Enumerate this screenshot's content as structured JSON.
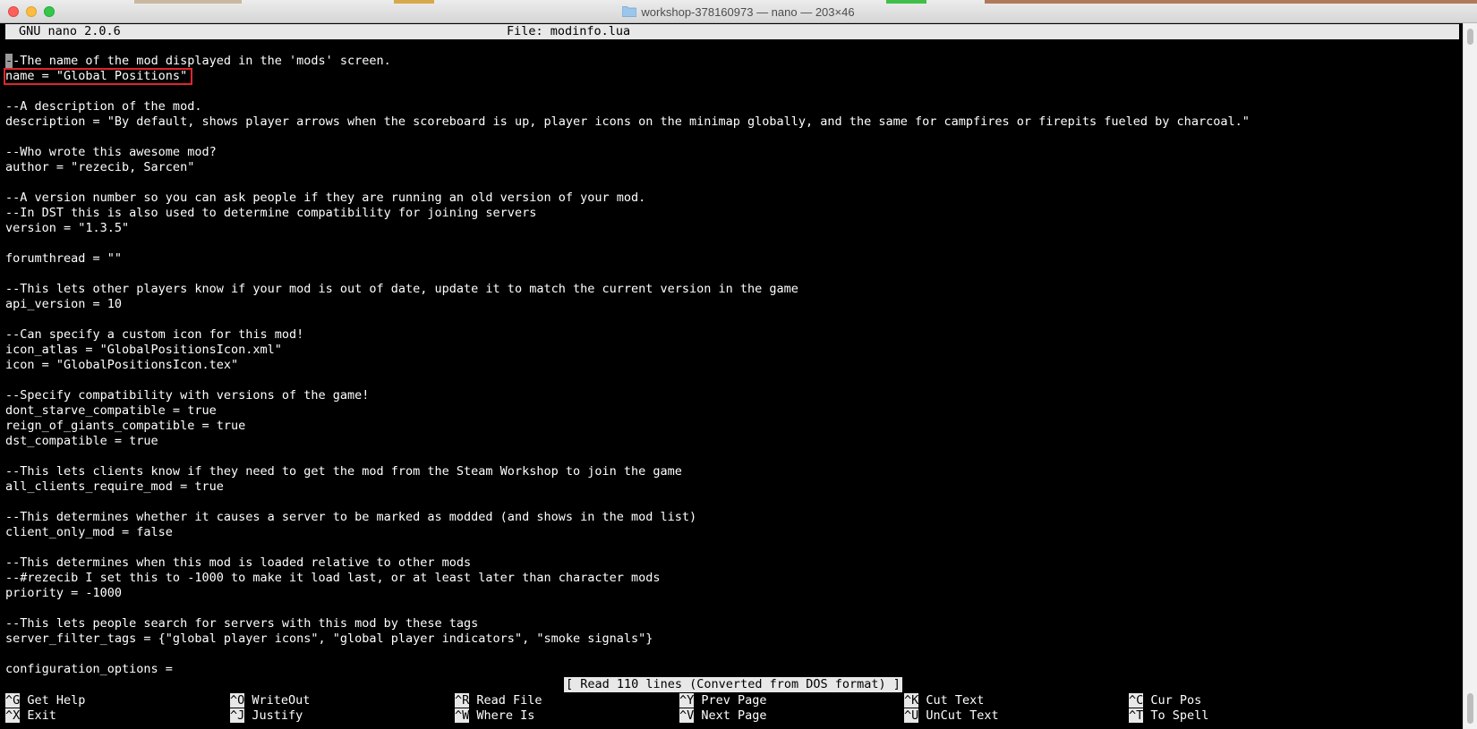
{
  "window": {
    "title": "workshop-378160973 — nano — 203×46"
  },
  "nano": {
    "version_label": "GNU nano 2.0.6",
    "file_label": "File: modinfo.lua",
    "status_message": "[ Read 110 lines (Converted from DOS format) ]"
  },
  "code_lines": [
    "--The name of the mod displayed in the 'mods' screen.",
    "name = \"Global Positions\"",
    "",
    "--A description of the mod.",
    "description = \"By default, shows player arrows when the scoreboard is up, player icons on the minimap globally, and the same for campfires or firepits fueled by charcoal.\"",
    "",
    "--Who wrote this awesome mod?",
    "author = \"rezecib, Sarcen\"",
    "",
    "--A version number so you can ask people if they are running an old version of your mod.",
    "--In DST this is also used to determine compatibility for joining servers",
    "version = \"1.3.5\"",
    "",
    "forumthread = \"\"",
    "",
    "--This lets other players know if your mod is out of date, update it to match the current version in the game",
    "api_version = 10",
    "",
    "--Can specify a custom icon for this mod!",
    "icon_atlas = \"GlobalPositionsIcon.xml\"",
    "icon = \"GlobalPositionsIcon.tex\"",
    "",
    "--Specify compatibility with versions of the game!",
    "dont_starve_compatible = true",
    "reign_of_giants_compatible = true",
    "dst_compatible = true",
    "",
    "--This lets clients know if they need to get the mod from the Steam Workshop to join the game",
    "all_clients_require_mod = true",
    "",
    "--This determines whether it causes a server to be marked as modded (and shows in the mod list)",
    "client_only_mod = false",
    "",
    "--This determines when this mod is loaded relative to other mods",
    "--#rezecib I set this to -1000 to make it load last, or at least later than character mods",
    "priority = -1000",
    "",
    "--This lets people search for servers with this mod by these tags",
    "server_filter_tags = {\"global player icons\", \"global player indicators\", \"smoke signals\"}",
    "",
    "configuration_options ="
  ],
  "shortcuts": [
    {
      "key": "^G",
      "label": "Get Help"
    },
    {
      "key": "^O",
      "label": "WriteOut"
    },
    {
      "key": "^R",
      "label": "Read File"
    },
    {
      "key": "^Y",
      "label": "Prev Page"
    },
    {
      "key": "^K",
      "label": "Cut Text"
    },
    {
      "key": "^C",
      "label": "Cur Pos"
    },
    {
      "key": "^X",
      "label": "Exit"
    },
    {
      "key": "^J",
      "label": "Justify"
    },
    {
      "key": "^W",
      "label": "Where Is"
    },
    {
      "key": "^V",
      "label": "Next Page"
    },
    {
      "key": "^U",
      "label": "UnCut Text"
    },
    {
      "key": "^T",
      "label": "To Spell"
    }
  ],
  "colors": {
    "terminal_bg": "#000000",
    "terminal_fg": "#ffffff",
    "bar_bg": "#e8e8e8",
    "annotation_box": "#e0252b"
  },
  "icons": {
    "window_close": "close-icon",
    "window_minimize": "minimize-icon",
    "window_maximize": "maximize-icon",
    "title_folder": "folder-icon"
  }
}
